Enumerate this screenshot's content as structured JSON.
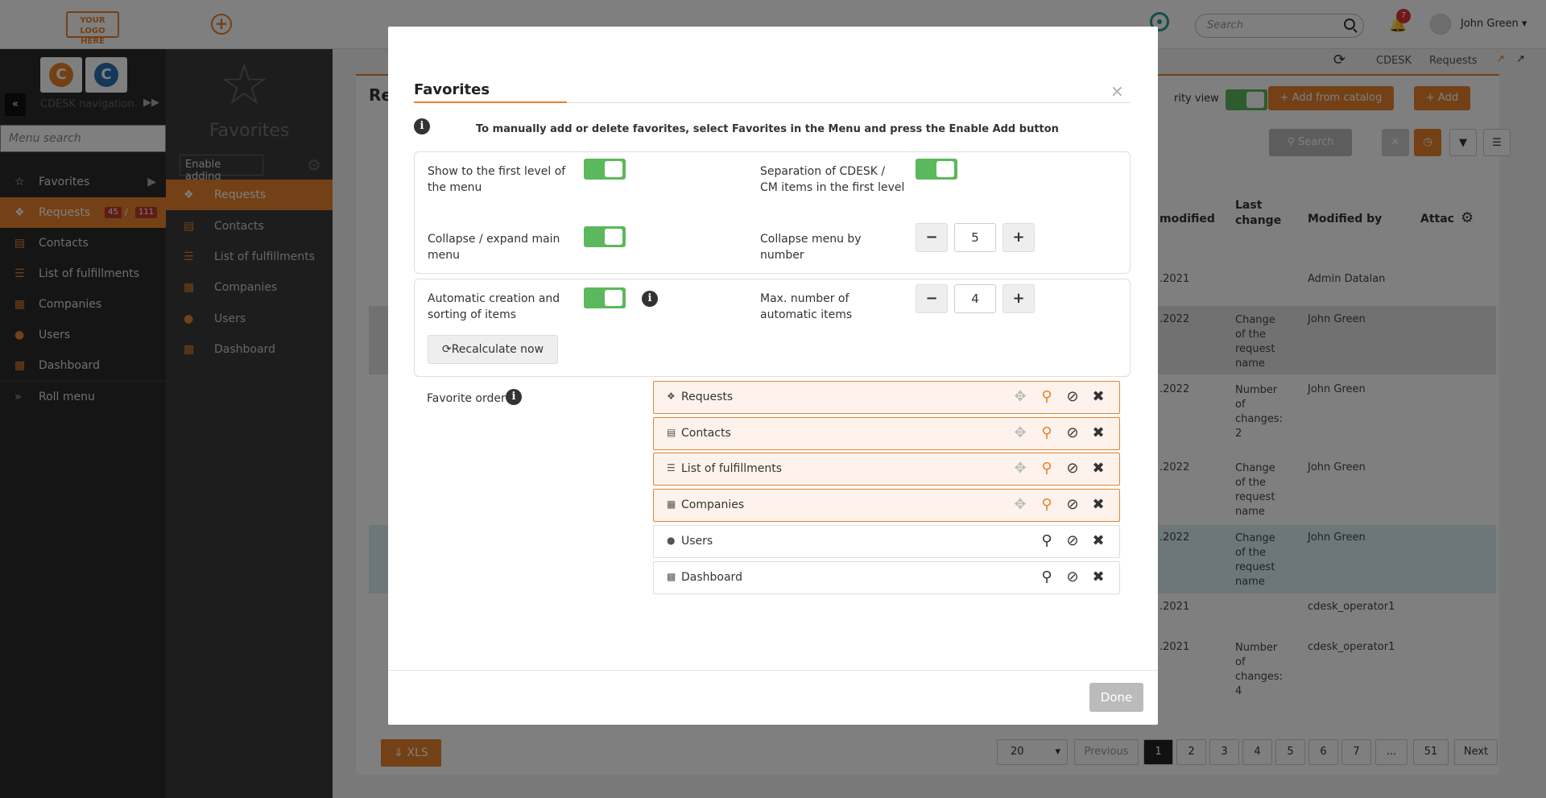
{
  "header": {
    "logo_text": "YOUR LOGO HERE",
    "search_placeholder": "Search",
    "notifications_count": "7",
    "user_name": "John Green"
  },
  "sidebar": {
    "nav_label": "CDESK navigation",
    "menu_search_placeholder": "Menu search",
    "items": [
      {
        "label": "Favorites",
        "icon": "star-icon"
      },
      {
        "label": "Requests",
        "icon": "requests-icon",
        "count_a": "45",
        "count_b": "111"
      },
      {
        "label": "Contacts",
        "icon": "contact-card-icon"
      },
      {
        "label": "List of fulfillments",
        "icon": "list-icon"
      },
      {
        "label": "Companies",
        "icon": "building-icon"
      },
      {
        "label": "Users",
        "icon": "user-icon"
      },
      {
        "label": "Dashboard",
        "icon": "bar-chart-icon"
      },
      {
        "label": "Roll menu",
        "icon": "double-chevron-icon"
      }
    ],
    "count_sep": "/"
  },
  "favorites_panel": {
    "title": "Favorites",
    "enable_button": "Enable adding",
    "items": [
      "Requests",
      "Contacts",
      "List of fulfillments",
      "Companies",
      "Users",
      "Dashboard"
    ]
  },
  "background_page": {
    "breadcrumb": [
      "CDESK",
      "Requests"
    ],
    "title_fragment": "Re",
    "activity_view_fragment": "rity view",
    "add_from_catalog": "Add from catalog",
    "add": "Add",
    "search_button": "Search",
    "columns": [
      "modified",
      "Last change",
      "Modified by",
      "Attac"
    ],
    "rows": [
      {
        "date": ".2021",
        "change": "",
        "by": "Admin Datalan"
      },
      {
        "date": ".2022",
        "change": "Change of the request name",
        "by": "John Green"
      },
      {
        "date": ".2022",
        "change": "Number of changes: 2",
        "by": "John Green"
      },
      {
        "date": ".2022",
        "change": "Change of the request name",
        "by": "John Green"
      },
      {
        "date": ".2022",
        "change": "Change of the request name",
        "by": "John Green"
      },
      {
        "date": ".2021",
        "change": "",
        "by": "cdesk_operator1"
      },
      {
        "date": ".2021",
        "change": "Number of changes: 4",
        "by": "cdesk_operator1"
      }
    ],
    "xls": "XLS",
    "page_size": "20",
    "pagination": [
      "Previous",
      "1",
      "2",
      "3",
      "4",
      "5",
      "6",
      "7",
      "...",
      "51",
      "Next"
    ]
  },
  "modal": {
    "title": "Favorites",
    "info_note": "To manually add or delete favorites, select Favorites in the Menu and press the Enable Add button",
    "show_first_level": "Show to the first level of the menu",
    "separation": "Separation of CDESK / CM items in the first level",
    "collapse_expand": "Collapse / expand main menu",
    "collapse_by_number": "Collapse menu by number",
    "collapse_number_value": "5",
    "auto_creation": "Automatic creation and sorting of items",
    "max_auto": "Max. number of automatic items",
    "max_auto_value": "4",
    "recalculate": "Recalculate now",
    "favorite_order": "Favorite order",
    "order_items": [
      {
        "label": "Requests",
        "icon": "requests-icon",
        "pinned": true
      },
      {
        "label": "Contacts",
        "icon": "contact-card-icon",
        "pinned": true
      },
      {
        "label": "List of fulfillments",
        "icon": "list-icon",
        "pinned": true
      },
      {
        "label": "Companies",
        "icon": "building-icon",
        "pinned": true
      },
      {
        "label": "Users",
        "icon": "user-icon",
        "pinned": false
      },
      {
        "label": "Dashboard",
        "icon": "bar-chart-icon",
        "pinned": false
      }
    ],
    "done": "Done",
    "close": "×"
  },
  "colors": {
    "accent": "#e8812b",
    "toggle_on": "#5cb85c",
    "sidebar_bg": "#2b2b2b"
  }
}
